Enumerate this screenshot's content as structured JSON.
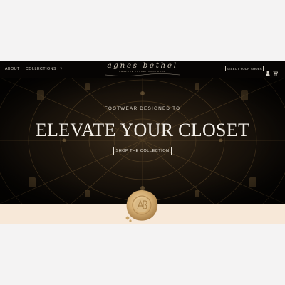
{
  "nav": {
    "about": "ABOUT",
    "collections": "COLLECTIONS",
    "collections_caret": "˅",
    "select_button": "SELECT YOUR SHOES",
    "account_icon": "user-icon",
    "cart_icon": "cart-icon"
  },
  "brand": {
    "name": "agnes bethel",
    "tagline": "BESPOKE LUXURY FOOTWEAR"
  },
  "hero": {
    "kicker": "FOOTWEAR DESIGNED TO",
    "title": "ELEVATE YOUR CLOSET",
    "cta": "SHOP THE COLLECTION"
  },
  "seal": {
    "icon": "wax-seal-icon",
    "monogram": "AB"
  },
  "colors": {
    "page_background": "#f4f3f3",
    "hero_background": "#0b0805",
    "band": "#f7e8d8",
    "gold": "#c9a46a",
    "text_light": "#f2eee8"
  }
}
